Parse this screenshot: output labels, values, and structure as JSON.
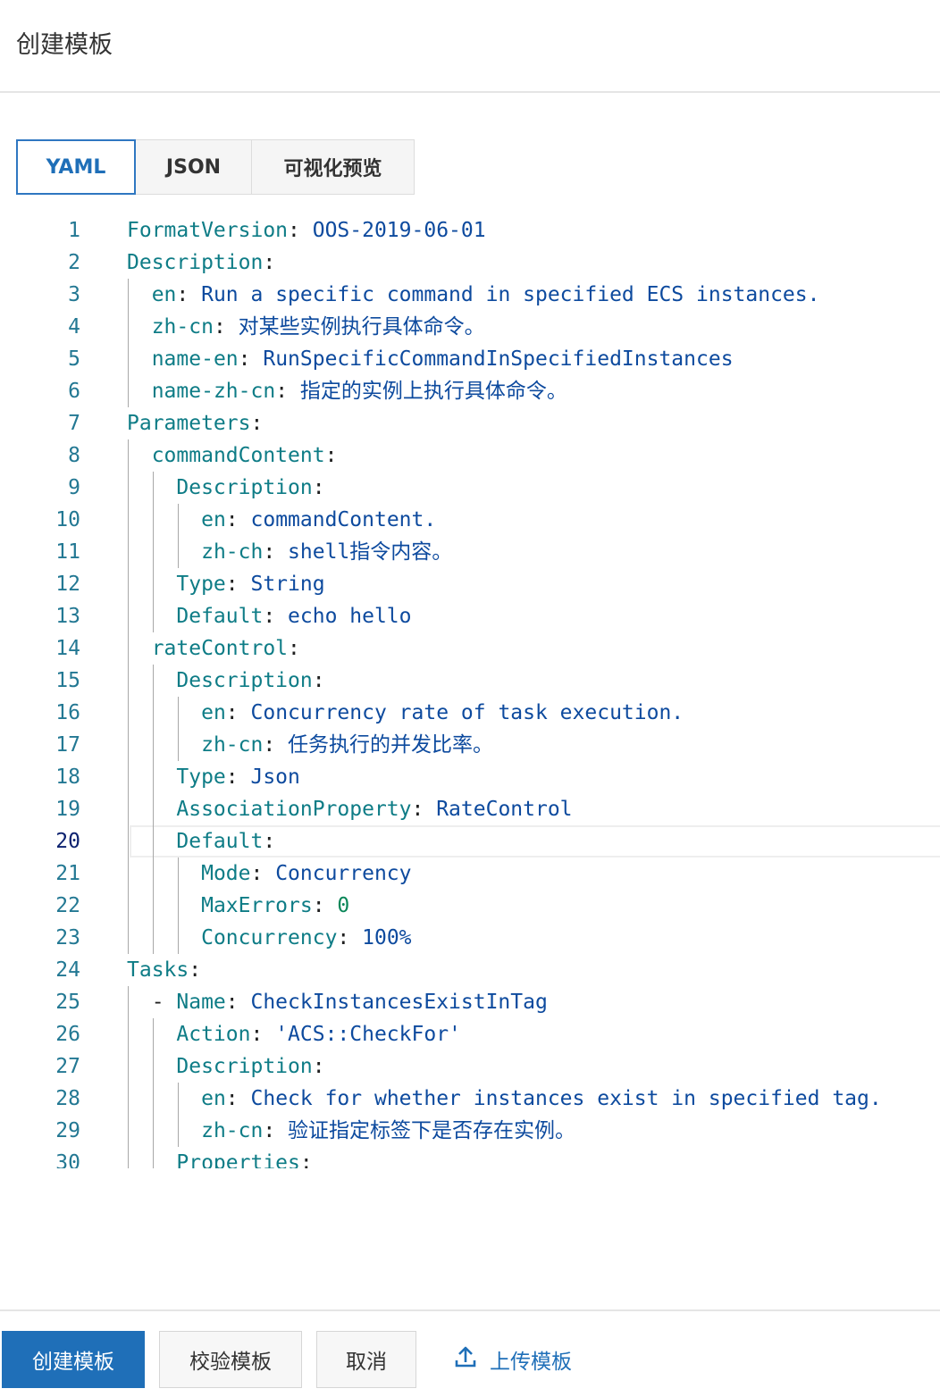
{
  "header": {
    "title": "创建模板"
  },
  "tabs": [
    {
      "label": "YAML",
      "active": true
    },
    {
      "label": "JSON",
      "active": false
    },
    {
      "label": "可视化预览",
      "active": false
    }
  ],
  "editor": {
    "current_line": 20,
    "lines": [
      [
        [
          "k",
          "FormatVersion"
        ],
        [
          "p",
          ": "
        ],
        [
          "v",
          "OOS-2019-06-01"
        ]
      ],
      [
        [
          "k",
          "Description"
        ],
        [
          "p",
          ":"
        ]
      ],
      [
        [
          "p",
          "  "
        ],
        [
          "k",
          "en"
        ],
        [
          "p",
          ": "
        ],
        [
          "v",
          "Run a specific command in specified ECS instances."
        ]
      ],
      [
        [
          "p",
          "  "
        ],
        [
          "k",
          "zh-cn"
        ],
        [
          "p",
          ": "
        ],
        [
          "v",
          "对某些实例执行具体命令。"
        ]
      ],
      [
        [
          "p",
          "  "
        ],
        [
          "k",
          "name-en"
        ],
        [
          "p",
          ": "
        ],
        [
          "v",
          "RunSpecificCommandInSpecifiedInstances"
        ]
      ],
      [
        [
          "p",
          "  "
        ],
        [
          "k",
          "name-zh-cn"
        ],
        [
          "p",
          ": "
        ],
        [
          "v",
          "指定的实例上执行具体命令。"
        ]
      ],
      [
        [
          "k",
          "Parameters"
        ],
        [
          "p",
          ":"
        ]
      ],
      [
        [
          "p",
          "  "
        ],
        [
          "k",
          "commandContent"
        ],
        [
          "p",
          ":"
        ]
      ],
      [
        [
          "p",
          "    "
        ],
        [
          "k",
          "Description"
        ],
        [
          "p",
          ":"
        ]
      ],
      [
        [
          "p",
          "      "
        ],
        [
          "k",
          "en"
        ],
        [
          "p",
          ": "
        ],
        [
          "v",
          "commandContent."
        ]
      ],
      [
        [
          "p",
          "      "
        ],
        [
          "k",
          "zh-ch"
        ],
        [
          "p",
          ": "
        ],
        [
          "v",
          "shell指令内容。"
        ]
      ],
      [
        [
          "p",
          "    "
        ],
        [
          "k",
          "Type"
        ],
        [
          "p",
          ": "
        ],
        [
          "v",
          "String"
        ]
      ],
      [
        [
          "p",
          "    "
        ],
        [
          "k",
          "Default"
        ],
        [
          "p",
          ": "
        ],
        [
          "v",
          "echo hello"
        ]
      ],
      [
        [
          "p",
          "  "
        ],
        [
          "k",
          "rateControl"
        ],
        [
          "p",
          ":"
        ]
      ],
      [
        [
          "p",
          "    "
        ],
        [
          "k",
          "Description"
        ],
        [
          "p",
          ":"
        ]
      ],
      [
        [
          "p",
          "      "
        ],
        [
          "k",
          "en"
        ],
        [
          "p",
          ": "
        ],
        [
          "v",
          "Concurrency rate of task execution."
        ]
      ],
      [
        [
          "p",
          "      "
        ],
        [
          "k",
          "zh-cn"
        ],
        [
          "p",
          ": "
        ],
        [
          "v",
          "任务执行的并发比率。"
        ]
      ],
      [
        [
          "p",
          "    "
        ],
        [
          "k",
          "Type"
        ],
        [
          "p",
          ": "
        ],
        [
          "v",
          "Json"
        ]
      ],
      [
        [
          "p",
          "    "
        ],
        [
          "k",
          "AssociationProperty"
        ],
        [
          "p",
          ": "
        ],
        [
          "v",
          "RateControl"
        ]
      ],
      [
        [
          "p",
          "    "
        ],
        [
          "k",
          "Default"
        ],
        [
          "p",
          ":"
        ]
      ],
      [
        [
          "p",
          "      "
        ],
        [
          "k",
          "Mode"
        ],
        [
          "p",
          ": "
        ],
        [
          "v",
          "Concurrency"
        ]
      ],
      [
        [
          "p",
          "      "
        ],
        [
          "k",
          "MaxErrors"
        ],
        [
          "p",
          ": "
        ],
        [
          "n",
          "0"
        ]
      ],
      [
        [
          "p",
          "      "
        ],
        [
          "k",
          "Concurrency"
        ],
        [
          "p",
          ": "
        ],
        [
          "v",
          "100%"
        ]
      ],
      [
        [
          "k",
          "Tasks"
        ],
        [
          "p",
          ":"
        ]
      ],
      [
        [
          "p",
          "  - "
        ],
        [
          "k",
          "Name"
        ],
        [
          "p",
          ": "
        ],
        [
          "v",
          "CheckInstancesExistInTag"
        ]
      ],
      [
        [
          "p",
          "    "
        ],
        [
          "k",
          "Action"
        ],
        [
          "p",
          ": "
        ],
        [
          "v",
          "'ACS::CheckFor'"
        ]
      ],
      [
        [
          "p",
          "    "
        ],
        [
          "k",
          "Description"
        ],
        [
          "p",
          ":"
        ]
      ],
      [
        [
          "p",
          "      "
        ],
        [
          "k",
          "en"
        ],
        [
          "p",
          ": "
        ],
        [
          "v",
          "Check for whether instances exist in specified tag."
        ]
      ],
      [
        [
          "p",
          "      "
        ],
        [
          "k",
          "zh-cn"
        ],
        [
          "p",
          ": "
        ],
        [
          "v",
          "验证指定标签下是否存在实例。"
        ]
      ],
      [
        [
          "p",
          "    "
        ],
        [
          "k",
          "Properties"
        ],
        [
          "p",
          ":"
        ]
      ]
    ]
  },
  "footer": {
    "create_label": "创建模板",
    "validate_label": "校验模板",
    "cancel_label": "取消",
    "upload_label": "上传模板",
    "upload_icon": "upload-icon"
  },
  "colors": {
    "accent": "#1f6fb8",
    "yaml_key": "#0e7c86",
    "yaml_value": "#0d4a9e"
  }
}
